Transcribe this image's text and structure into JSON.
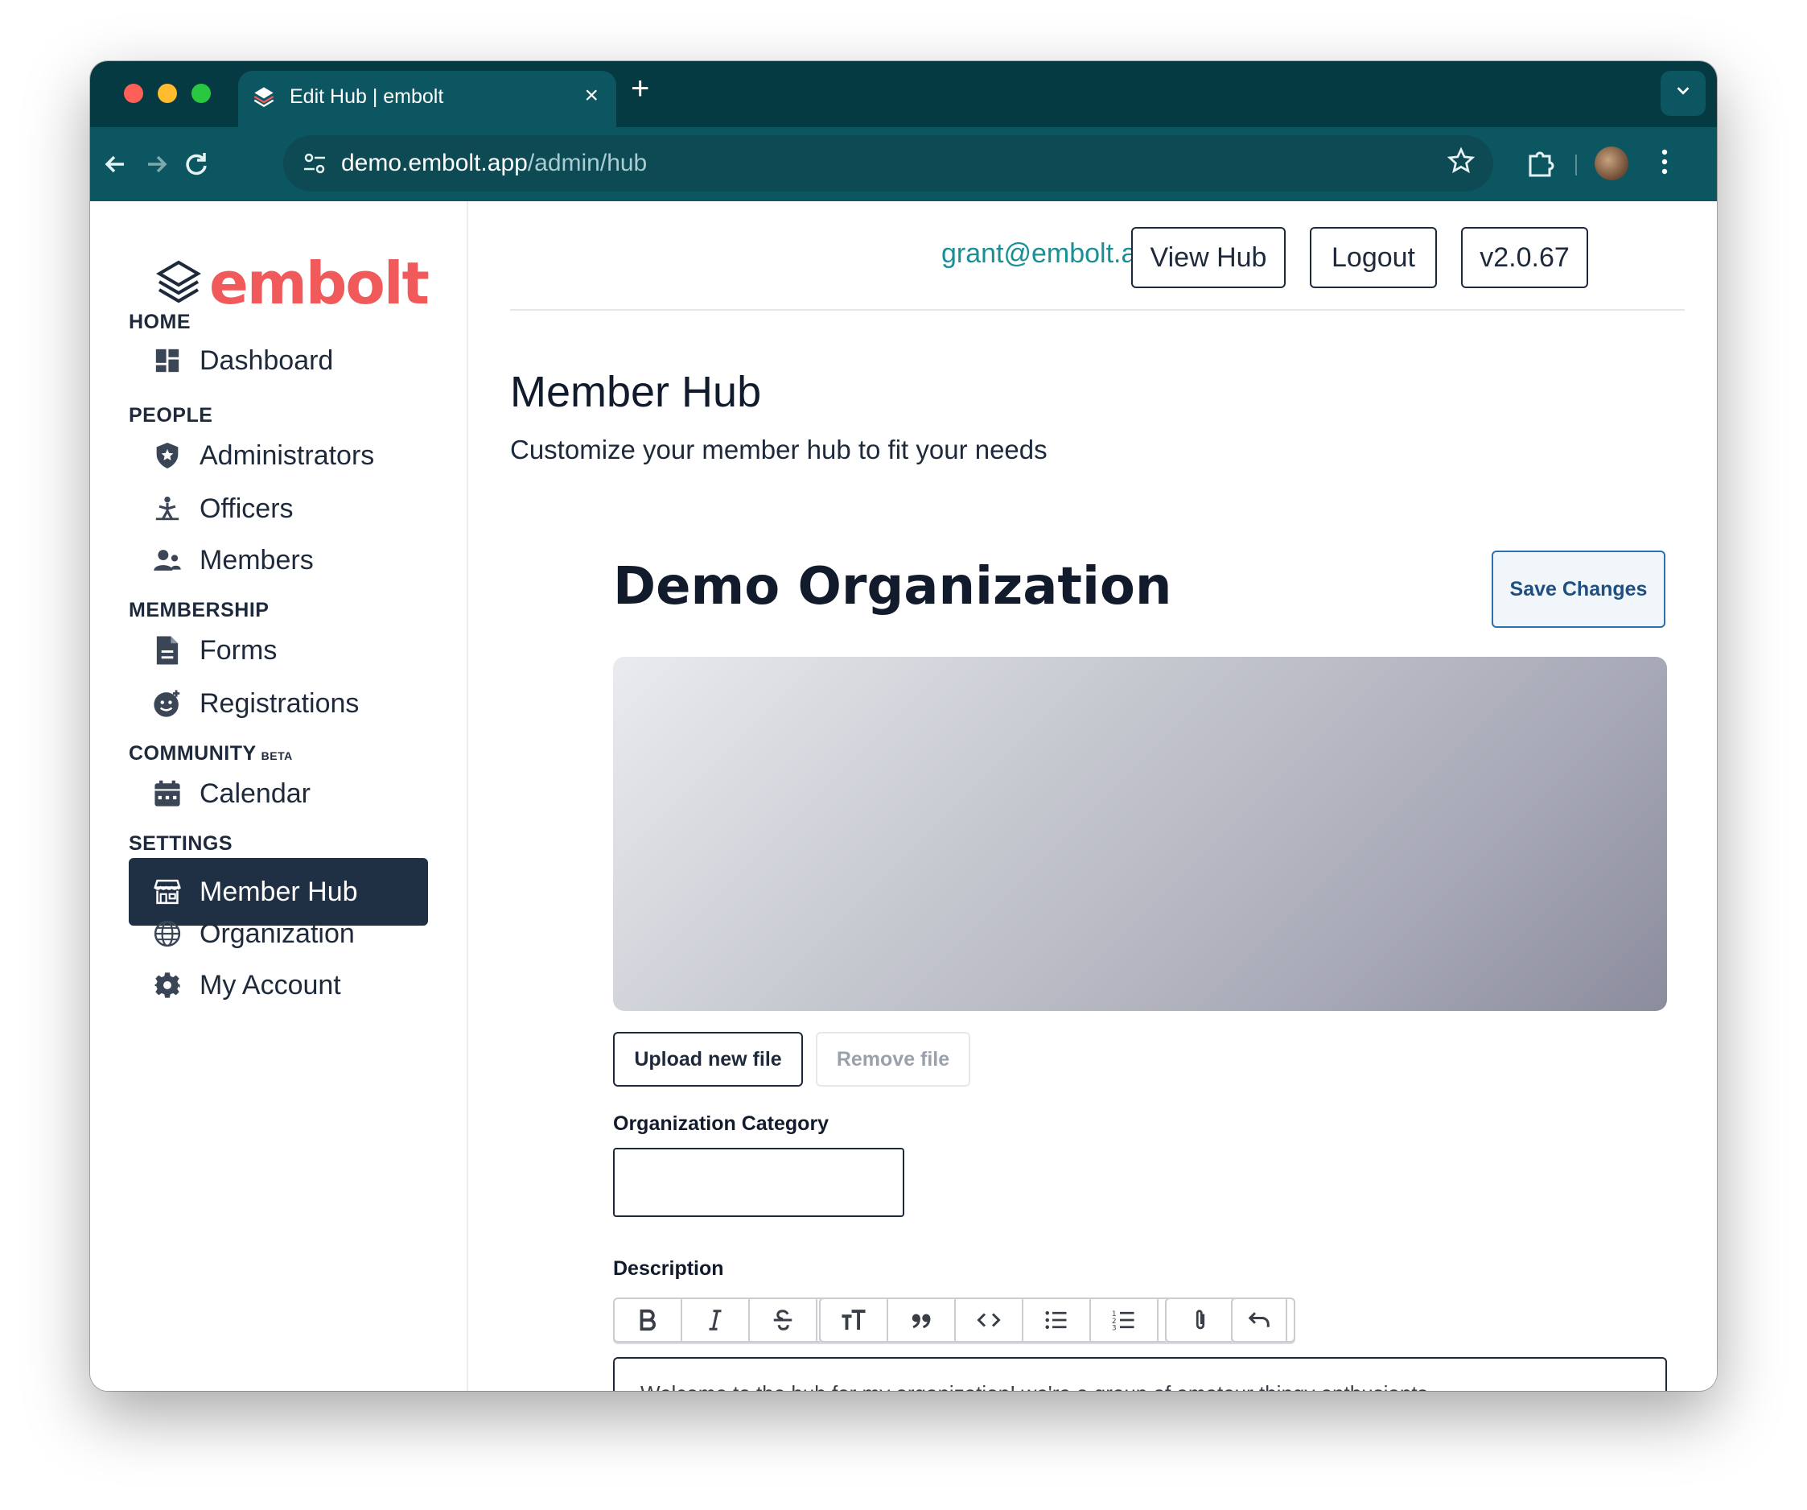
{
  "browser": {
    "tab_title": "Edit Hub | embolt",
    "tab_close": "×",
    "new_tab": "+",
    "url_domain": "demo.embolt.app",
    "url_path": "/admin/hub",
    "traffic_lights": [
      "#fe5f57",
      "#febc2e",
      "#28c840"
    ]
  },
  "brand": {
    "name": "embolt",
    "color": "#f05a5b"
  },
  "sidebar": {
    "sections": [
      {
        "label": "HOME",
        "items": [
          {
            "label": "Dashboard",
            "icon": "dashboard-icon"
          }
        ]
      },
      {
        "label": "PEOPLE",
        "items": [
          {
            "label": "Administrators",
            "icon": "shield-star-icon"
          },
          {
            "label": "Officers",
            "icon": "person-podium-icon"
          },
          {
            "label": "Members",
            "icon": "users-icon"
          }
        ]
      },
      {
        "label": "MEMBERSHIP",
        "items": [
          {
            "label": "Forms",
            "icon": "document-icon"
          },
          {
            "label": "Registrations",
            "icon": "face-plus-icon"
          }
        ]
      },
      {
        "label": "COMMUNITY",
        "badge": "BETA",
        "items": [
          {
            "label": "Calendar",
            "icon": "calendar-icon"
          }
        ]
      },
      {
        "label": "SETTINGS",
        "items": [
          {
            "label": "Member Hub",
            "icon": "storefront-icon",
            "active": true
          },
          {
            "label": "Organization",
            "icon": "globe-icon"
          },
          {
            "label": "My Account",
            "icon": "gear-icon"
          }
        ]
      }
    ]
  },
  "header": {
    "user_email": "grant@embolt.app",
    "view_hub": "View Hub",
    "logout": "Logout",
    "version": "v2.0.67"
  },
  "page": {
    "title": "Member Hub",
    "subtitle": "Customize your member hub to fit your needs"
  },
  "hub": {
    "org_name": "Demo Organization",
    "save_label": "Save Changes",
    "upload_label": "Upload new file",
    "remove_label": "Remove file",
    "category_label": "Organization Category",
    "category_value": "",
    "description_label": "Description",
    "description_text": "Welcome to the hub for my organization! we're a group of amateur thingy enthusiants...",
    "toolbar_buttons": [
      "bold",
      "italic",
      "strikethrough",
      "link",
      "heading",
      "quote",
      "code",
      "bullet-list",
      "numbered-list",
      "outdent",
      "indent",
      "attach",
      "undo"
    ]
  }
}
